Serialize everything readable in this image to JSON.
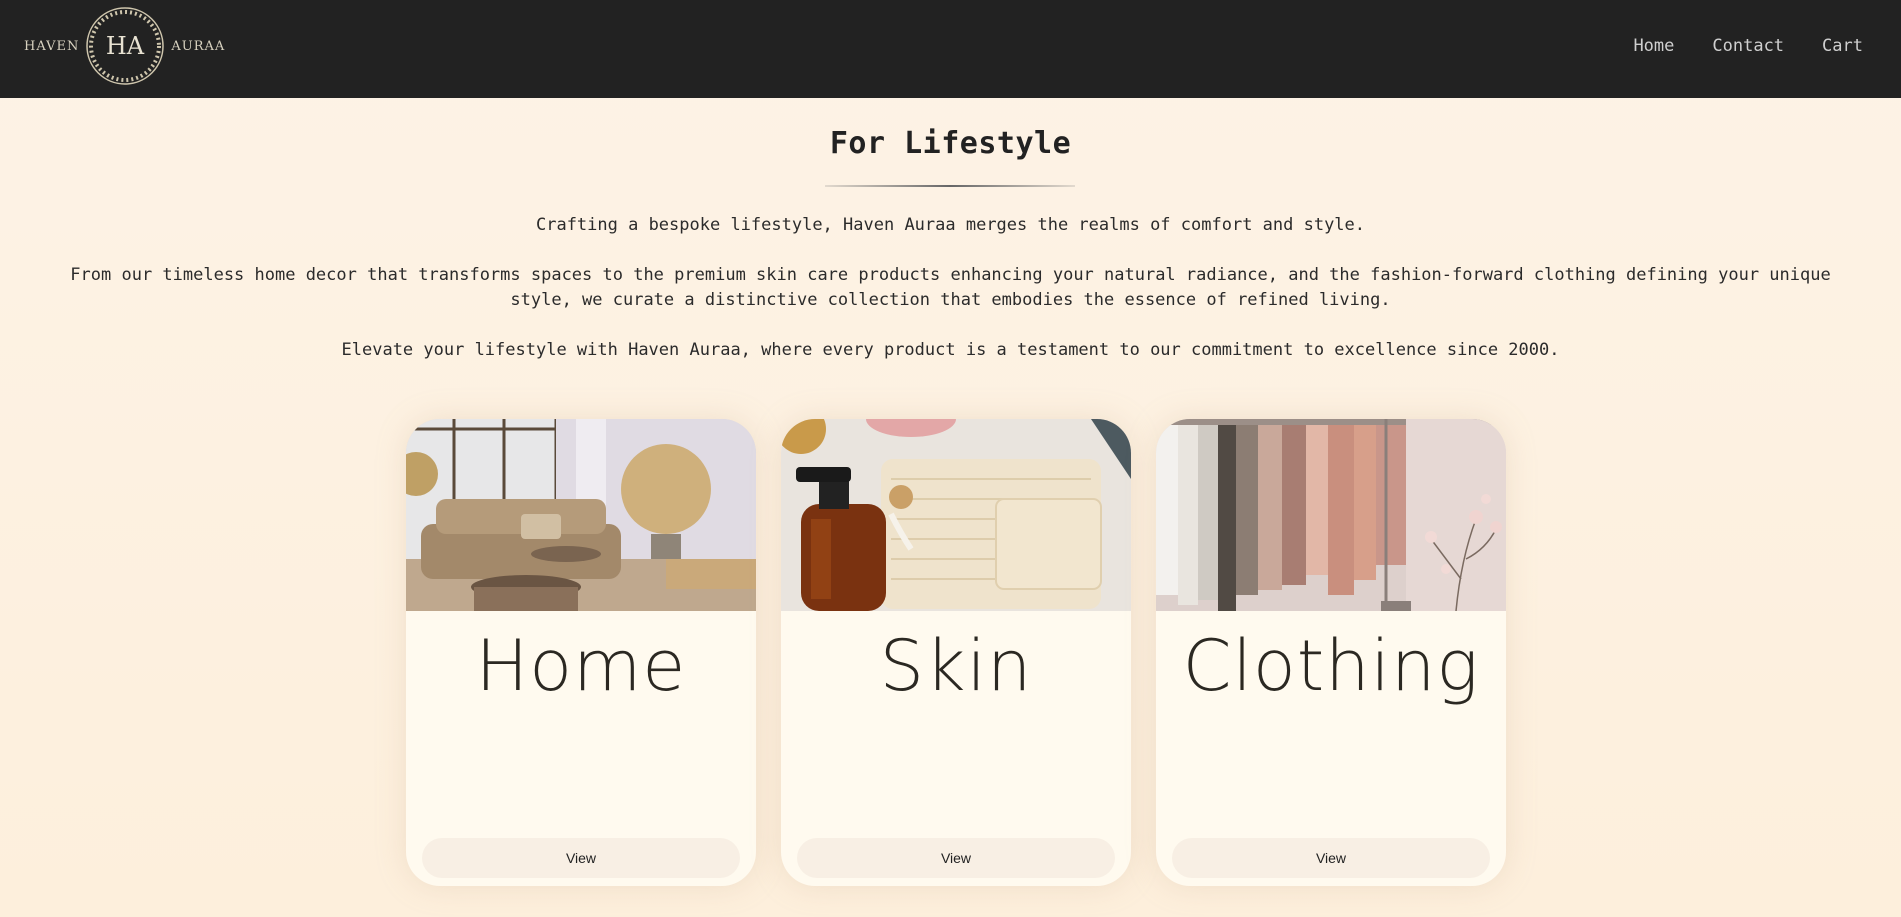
{
  "header": {
    "logo": {
      "left_word": "HAVEN",
      "monogram": "HA",
      "right_word": "AURAA"
    },
    "nav": [
      {
        "label": "Home"
      },
      {
        "label": "Contact"
      },
      {
        "label": "Cart"
      }
    ]
  },
  "intro": {
    "title": "For Lifestyle",
    "paragraph_1": "Crafting a bespoke lifestyle, Haven Auraa merges the realms of comfort and style.",
    "paragraph_2": "From our timeless home decor that transforms spaces to the premium skin care products enhancing your natural radiance, and the fashion-forward clothing defining your unique style, we curate a distinctive collection that embodies the essence of refined living.",
    "paragraph_3": "Elevate your lifestyle with Haven Auraa, where every product is a testament to our commitment to excellence since 2000."
  },
  "cards": [
    {
      "title": "Home",
      "button": "View",
      "image": "living-room-photo"
    },
    {
      "title": "Skin",
      "button": "View",
      "image": "skincare-products-photo"
    },
    {
      "title": "Clothing",
      "button": "View",
      "image": "clothing-rack-photo"
    }
  ],
  "colors": {
    "header_bg": "#222222",
    "page_bg": "#fdf3e6",
    "card_bg": "#fffaef",
    "button_bg": "#f8efe4"
  }
}
